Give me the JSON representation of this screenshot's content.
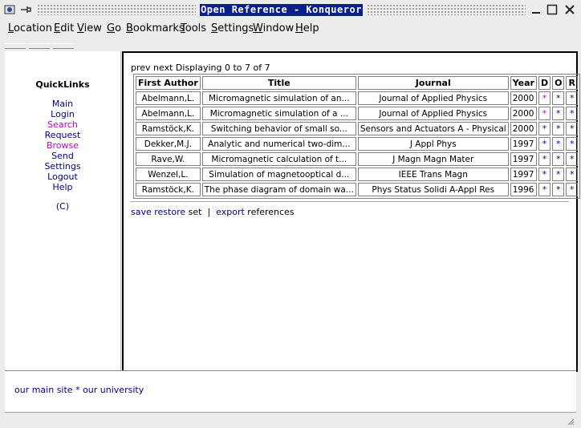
{
  "window": {
    "title": "Open Reference - Konqueror"
  },
  "menu": [
    {
      "label": "Location",
      "accel": "L",
      "rest": "ocation"
    },
    {
      "label": "Edit",
      "accel": "E",
      "rest": "dit"
    },
    {
      "label": "View",
      "accel": "V",
      "rest": "iew"
    },
    {
      "label": "Go",
      "accel": "G",
      "rest": "o"
    },
    {
      "label": "Bookmarks",
      "accel": "B",
      "rest": "ookmarks"
    },
    {
      "label": "Tools",
      "accel": "T",
      "rest": "ools"
    },
    {
      "label": "Settings",
      "accel": "S",
      "rest": "ettings"
    },
    {
      "label": "Window",
      "accel": "W",
      "rest": "indow"
    },
    {
      "label": "Help",
      "accel": "H",
      "rest": "elp"
    }
  ],
  "sidebar": {
    "heading": "QuickLinks",
    "links": [
      {
        "label": "Main",
        "visited": false
      },
      {
        "label": "Login",
        "visited": false
      },
      {
        "label": "Search",
        "visited": true
      },
      {
        "label": "Request",
        "visited": false
      },
      {
        "label": "Browse",
        "visited": true
      },
      {
        "label": "Send",
        "visited": false
      },
      {
        "label": "Settings",
        "visited": false
      },
      {
        "label": "Logout",
        "visited": false
      },
      {
        "label": "Help",
        "visited": false
      }
    ],
    "copyright": "(C)"
  },
  "results": {
    "prev": "prev",
    "next": "next",
    "displaying": "Displaying 0 to 7 of 7",
    "headers": [
      "First Author",
      "Title",
      "Journal",
      "Year",
      "D",
      "O",
      "R"
    ],
    "rows": [
      {
        "author": "Abelmann,L.",
        "title": "Micromagnetic simulation of an...",
        "journal": "Journal of Applied Physics",
        "year": "2000",
        "d_visited": true
      },
      {
        "author": "Abelmann,L.",
        "title": "Micromagnetic simulation of a ...",
        "journal": "Journal of Applied Physics",
        "year": "2000",
        "d_visited": true
      },
      {
        "author": "Ramstöck,K.",
        "title": "Switching behavior of small so...",
        "journal": "Sensors and Actuators A - Physical",
        "year": "2000",
        "d_visited": false
      },
      {
        "author": "Dekker,M.J.",
        "title": "Analytic and numerical two-dim...",
        "journal": "J Appl Phys",
        "year": "1997",
        "d_visited": false
      },
      {
        "author": "Rave,W.",
        "title": "Micromagnetic calculation of t...",
        "journal": "J Magn Magn Mater",
        "year": "1997",
        "d_visited": false
      },
      {
        "author": "Wenzel,L.",
        "title": "Simulation of magnetooptical d...",
        "journal": "IEEE Trans Magn",
        "year": "1997",
        "d_visited": false
      },
      {
        "author": "Ramstöck,K.",
        "title": "The phase diagram of domain wa...",
        "journal": "Phys Status Solidi A-Appl Res",
        "year": "1996",
        "d_visited": false
      }
    ],
    "cell_link": "*"
  },
  "footer_actions": {
    "save": "save",
    "restore": "restore",
    "set": "set",
    "sep": "|",
    "export": "export",
    "references": "references"
  },
  "bottom": {
    "main_site": "our main site",
    "star": "*",
    "university": "our university"
  },
  "colors": {
    "link": "#00008b",
    "visited": "#c000c0",
    "title_bg": "#0a1e8c"
  }
}
